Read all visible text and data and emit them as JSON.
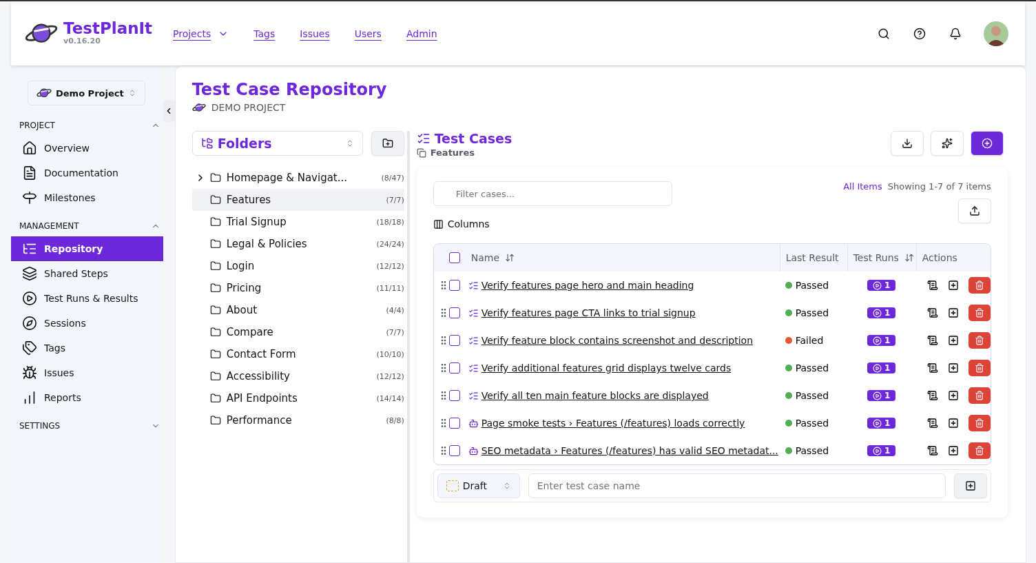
{
  "header": {
    "brand": "TestPlanIt",
    "version": "v0.16.20",
    "nav": [
      {
        "label": "Projects",
        "dropdown": true
      },
      {
        "label": "Tags",
        "dropdown": false
      },
      {
        "label": "Issues",
        "dropdown": false
      },
      {
        "label": "Users",
        "dropdown": false
      },
      {
        "label": "Admin",
        "dropdown": false
      }
    ]
  },
  "sidebar": {
    "project": "Demo Project",
    "sections": [
      {
        "title": "PROJECT",
        "expanded": true,
        "items": [
          {
            "label": "Overview",
            "selected": false
          },
          {
            "label": "Documentation",
            "selected": false
          },
          {
            "label": "Milestones",
            "selected": false
          }
        ]
      },
      {
        "title": "MANAGEMENT",
        "expanded": true,
        "items": [
          {
            "label": "Repository",
            "selected": true
          },
          {
            "label": "Shared Steps",
            "selected": false
          },
          {
            "label": "Test Runs & Results",
            "selected": false
          },
          {
            "label": "Sessions",
            "selected": false
          },
          {
            "label": "Tags",
            "selected": false
          },
          {
            "label": "Issues",
            "selected": false
          },
          {
            "label": "Reports",
            "selected": false
          }
        ]
      },
      {
        "title": "SETTINGS",
        "expanded": false
      }
    ]
  },
  "page": {
    "title": "Test Case Repository",
    "project": "DEMO PROJECT"
  },
  "folders": {
    "title": "Folders",
    "items": [
      {
        "name": "Homepage & Navigat...",
        "count": "(8/47)",
        "expandable": true,
        "selected": false
      },
      {
        "name": "Features",
        "count": "(7/7)",
        "expandable": false,
        "selected": true
      },
      {
        "name": "Trial Signup",
        "count": "(18/18)",
        "expandable": false,
        "selected": false
      },
      {
        "name": "Legal & Policies",
        "count": "(24/24)",
        "expandable": false,
        "selected": false
      },
      {
        "name": "Login",
        "count": "(12/12)",
        "expandable": false,
        "selected": false
      },
      {
        "name": "Pricing",
        "count": "(11/11)",
        "expandable": false,
        "selected": false
      },
      {
        "name": "About",
        "count": "(4/4)",
        "expandable": false,
        "selected": false
      },
      {
        "name": "Compare",
        "count": "(7/7)",
        "expandable": false,
        "selected": false
      },
      {
        "name": "Contact Form",
        "count": "(10/10)",
        "expandable": false,
        "selected": false
      },
      {
        "name": "Accessibility",
        "count": "(12/12)",
        "expandable": false,
        "selected": false
      },
      {
        "name": "API Endpoints",
        "count": "(14/14)",
        "expandable": false,
        "selected": false
      },
      {
        "name": "Performance",
        "count": "(8/8)",
        "expandable": false,
        "selected": false
      }
    ]
  },
  "test_cases": {
    "title": "Test Cases",
    "folder": "Features",
    "filter_placeholder": "Filter cases...",
    "all_items": "All Items",
    "showing": "Showing 1-7 of 7 items",
    "columns_button": "Columns",
    "select_all_checked": false,
    "columns": [
      {
        "label": "Name",
        "sortable": true
      },
      {
        "label": "Last Result",
        "sortable": false
      },
      {
        "label": "Test Runs",
        "sortable": true
      },
      {
        "label": "Actions",
        "sortable": false
      }
    ],
    "rows": [
      {
        "kind": "manual",
        "name": "Verify features page hero and main heading",
        "checked": false,
        "result": "Passed",
        "color": "#4caf50",
        "runs": "1"
      },
      {
        "kind": "manual",
        "name": "Verify features page CTA links to trial signup",
        "checked": false,
        "result": "Passed",
        "color": "#4caf50",
        "runs": "1"
      },
      {
        "kind": "manual",
        "name": "Verify feature block contains screenshot and description",
        "checked": false,
        "result": "Failed",
        "color": "#e8572f",
        "runs": "1"
      },
      {
        "kind": "manual",
        "name": "Verify additional features grid displays twelve cards",
        "checked": false,
        "result": "Passed",
        "color": "#4caf50",
        "runs": "1"
      },
      {
        "kind": "manual",
        "name": "Verify all ten main feature blocks are displayed",
        "checked": false,
        "result": "Passed",
        "color": "#4caf50",
        "runs": "1"
      },
      {
        "kind": "automated",
        "name": "Page smoke tests › Features (/features) loads correctly",
        "checked": false,
        "result": "Passed",
        "color": "#4caf50",
        "runs": "1"
      },
      {
        "kind": "automated",
        "name": "SEO metadata › Features (/features) has valid SEO metadat...",
        "checked": false,
        "result": "Passed",
        "color": "#4caf50",
        "runs": "1"
      }
    ],
    "new_case": {
      "state": "Draft",
      "placeholder": "Enter test case name"
    }
  }
}
